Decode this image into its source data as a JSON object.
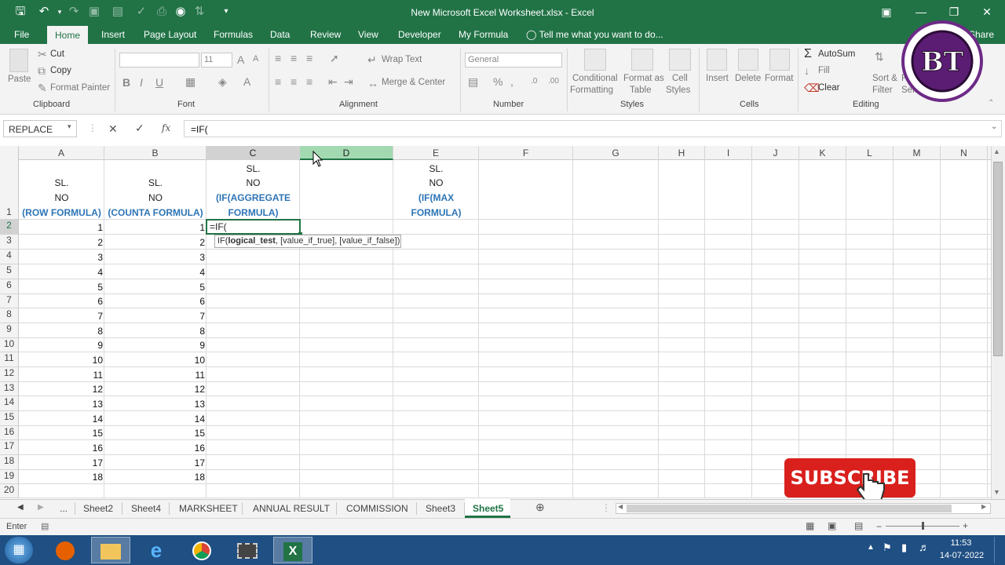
{
  "app": {
    "title": "New Microsoft Excel Worksheet.xlsx - Excel"
  },
  "tabs": [
    {
      "label": "File"
    },
    {
      "label": "Home"
    },
    {
      "label": "Insert"
    },
    {
      "label": "Page Layout"
    },
    {
      "label": "Formulas"
    },
    {
      "label": "Data"
    },
    {
      "label": "Review"
    },
    {
      "label": "View"
    },
    {
      "label": "Developer"
    },
    {
      "label": "My Formula"
    }
  ],
  "tell_me": "Tell me what you want to do...",
  "share_label": "Share",
  "ribbon": {
    "clipboard": {
      "paste": "Paste",
      "cut": "Cut",
      "copy": "Copy",
      "format_painter": "Format Painter",
      "label": "Clipboard"
    },
    "font": {
      "font_name": "",
      "font_size": "11",
      "label": "Font"
    },
    "alignment": {
      "wrap_text": "Wrap Text",
      "merge_center": "Merge & Center",
      "label": "Alignment"
    },
    "number": {
      "format": "General",
      "label": "Number"
    },
    "styles": {
      "conditional": "Conditional",
      "conditional2": "Formatting",
      "format_as": "Format as",
      "format_as2": "Table",
      "cell_styles": "Cell",
      "cell_styles2": "Styles",
      "label": "Styles"
    },
    "cells": {
      "insert": "Insert",
      "delete": "Delete",
      "format": "Format",
      "label": "Cells"
    },
    "editing": {
      "autosum": "AutoSum",
      "fill": "Fill",
      "clear": "Clear",
      "sort": "Sort &",
      "sort2": "Filter",
      "find": "Find &",
      "find2": "Select",
      "label": "Editing"
    }
  },
  "formula_bar": {
    "name_box": "REPLACE",
    "fx": "fx",
    "formula": "=IF("
  },
  "columns": [
    "A",
    "B",
    "C",
    "D",
    "E",
    "F",
    "G",
    "H",
    "I",
    "J",
    "K",
    "L",
    "M",
    "N"
  ],
  "rows": [
    "1",
    "2",
    "3",
    "4",
    "5",
    "6",
    "7",
    "8",
    "9",
    "10",
    "11",
    "12",
    "13",
    "14",
    "15",
    "16",
    "17",
    "18",
    "19",
    "20"
  ],
  "headers": {
    "a": [
      "SL.",
      "NO",
      "(ROW FORMULA)"
    ],
    "b": [
      "SL.",
      "NO",
      "(COUNTA FORMULA)"
    ],
    "c": [
      "SL.",
      "NO",
      "(IF(AGGREGATE",
      "FORMULA)"
    ],
    "e": [
      "SL.",
      "NO",
      "(IF(MAX",
      "FORMULA)"
    ]
  },
  "col_a": [
    "1",
    "2",
    "3",
    "4",
    "5",
    "6",
    "7",
    "8",
    "9",
    "10",
    "11",
    "12",
    "13",
    "14",
    "15",
    "16",
    "17",
    "18"
  ],
  "col_b": [
    "1",
    "2",
    "3",
    "4",
    "5",
    "6",
    "7",
    "8",
    "9",
    "10",
    "11",
    "12",
    "13",
    "14",
    "15",
    "16",
    "17",
    "18"
  ],
  "active_cell": {
    "text": "=IF("
  },
  "tooltip": {
    "fn": "IF(",
    "bold": "logical_test",
    "rest": ", [value_if_true], [value_if_false])"
  },
  "sheet_tabs": [
    "...",
    "Sheet2",
    "Sheet4",
    "MARKSHEET",
    "ANNUAL RESULT",
    "COMMISSION",
    "Sheet3",
    "Sheet5"
  ],
  "active_sheet": "Sheet5",
  "status": {
    "mode": "Enter"
  },
  "subscribe": "SUBSCRIBE",
  "taskbar": {
    "time": "11:53",
    "date": "14-07-2022"
  },
  "colors": {
    "excel_green": "#217346",
    "header_blue": "#2e75b6",
    "subscribe_red": "#d9201d"
  }
}
